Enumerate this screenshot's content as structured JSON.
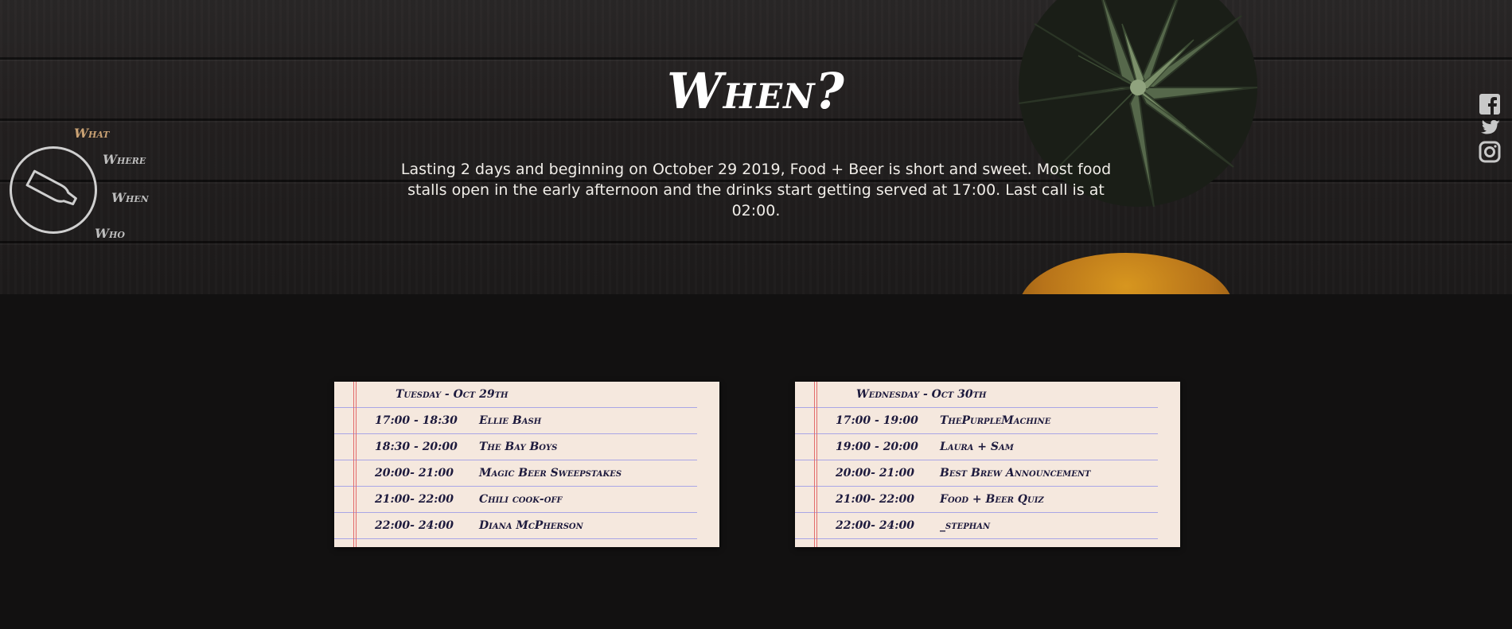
{
  "hero": {
    "title": "When?",
    "text": "Lasting 2 days and beginning on October 29 2019, Food + Beer is short and sweet. Most food stalls open in the early afternoon and the drinks start getting served at 17:00. Last call is at 02:00."
  },
  "nav": {
    "items": [
      {
        "label": "What",
        "active": true
      },
      {
        "label": "Where",
        "active": false
      },
      {
        "label": "When",
        "active": false
      },
      {
        "label": "Who",
        "active": false
      }
    ]
  },
  "social": [
    "facebook-icon",
    "twitter-icon",
    "instagram-icon"
  ],
  "schedule": [
    {
      "day": "Tuesday - Oct 29th",
      "rows": [
        {
          "time": "17:00 - 18:30",
          "act": "Ellie Bash"
        },
        {
          "time": "18:30 - 20:00",
          "act": "The Bay Boys"
        },
        {
          "time": "20:00- 21:00",
          "act": "Magic Beer Sweepstakes"
        },
        {
          "time": "21:00- 22:00",
          "act": "Chili cook-off"
        },
        {
          "time": "22:00- 24:00",
          "act": "Diana McPherson"
        }
      ]
    },
    {
      "day": "Wednesday - Oct 30th",
      "rows": [
        {
          "time": "17:00 - 19:00",
          "act": "ThePurpleMachine"
        },
        {
          "time": "19:00 - 20:00",
          "act": "Laura + Sam"
        },
        {
          "time": "20:00- 21:00",
          "act": "Best Brew Announcement"
        },
        {
          "time": "21:00- 22:00",
          "act": "Food + Beer Quiz"
        },
        {
          "time": "22:00- 24:00",
          "act": "_stephan"
        }
      ]
    }
  ],
  "colors": {
    "accent_nav": "#c9a173",
    "paper": "#f5e8de",
    "ink": "#1d1a3d",
    "margin_line": "#e36b6b",
    "rule_line": "#a9a6e6"
  }
}
